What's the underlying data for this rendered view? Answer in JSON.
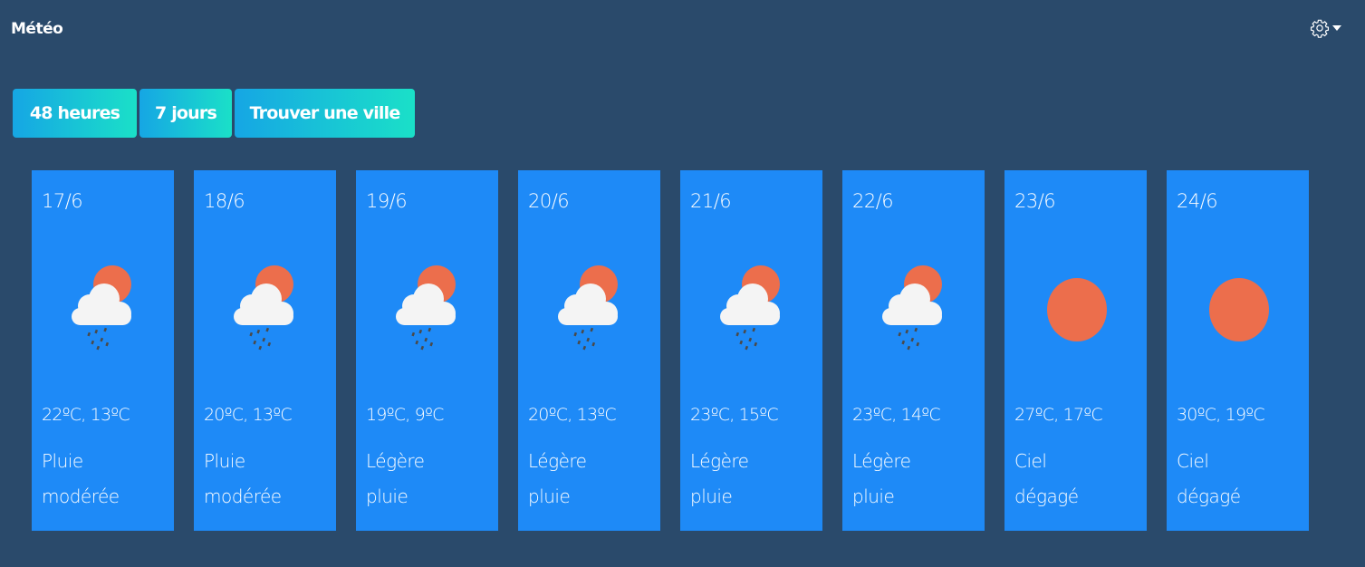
{
  "widget": {
    "title": "Météo",
    "settings_icon": "gear-icon"
  },
  "tabs": [
    {
      "label": "48 heures"
    },
    {
      "label": "7 jours"
    },
    {
      "label": "Trouver une ville"
    }
  ],
  "colors": {
    "background": "#2a4a6b",
    "day_card": "#1e8af7",
    "tab_gradient_start": "#16a6e4",
    "tab_gradient_end": "#1ae0c8",
    "sun": "#ec6e4c",
    "cloud": "#f4f4f4"
  },
  "days": [
    {
      "date": "17/6",
      "temps": "22ºC, 13ºC",
      "cond_1": "Pluie",
      "cond_2": "modérée",
      "icon": "cloud-sun-rain-icon"
    },
    {
      "date": "18/6",
      "temps": "20ºC, 13ºC",
      "cond_1": "Pluie",
      "cond_2": "modérée",
      "icon": "cloud-sun-rain-icon"
    },
    {
      "date": "19/6",
      "temps": "19ºC, 9ºC",
      "cond_1": "Légère",
      "cond_2": "pluie",
      "icon": "cloud-sun-rain-icon"
    },
    {
      "date": "20/6",
      "temps": "20ºC, 13ºC",
      "cond_1": "Légère",
      "cond_2": "pluie",
      "icon": "cloud-sun-rain-icon"
    },
    {
      "date": "21/6",
      "temps": "23ºC, 15ºC",
      "cond_1": "Légère",
      "cond_2": "pluie",
      "icon": "cloud-sun-rain-icon"
    },
    {
      "date": "22/6",
      "temps": "23ºC, 14ºC",
      "cond_1": "Légère",
      "cond_2": "pluie",
      "icon": "cloud-sun-rain-icon"
    },
    {
      "date": "23/6",
      "temps": "27ºC, 17ºC",
      "cond_1": "Ciel",
      "cond_2": "dégagé",
      "icon": "sun-icon"
    },
    {
      "date": "24/6",
      "temps": "30ºC, 19ºC",
      "cond_1": "Ciel",
      "cond_2": "dégagé",
      "icon": "sun-icon"
    }
  ]
}
